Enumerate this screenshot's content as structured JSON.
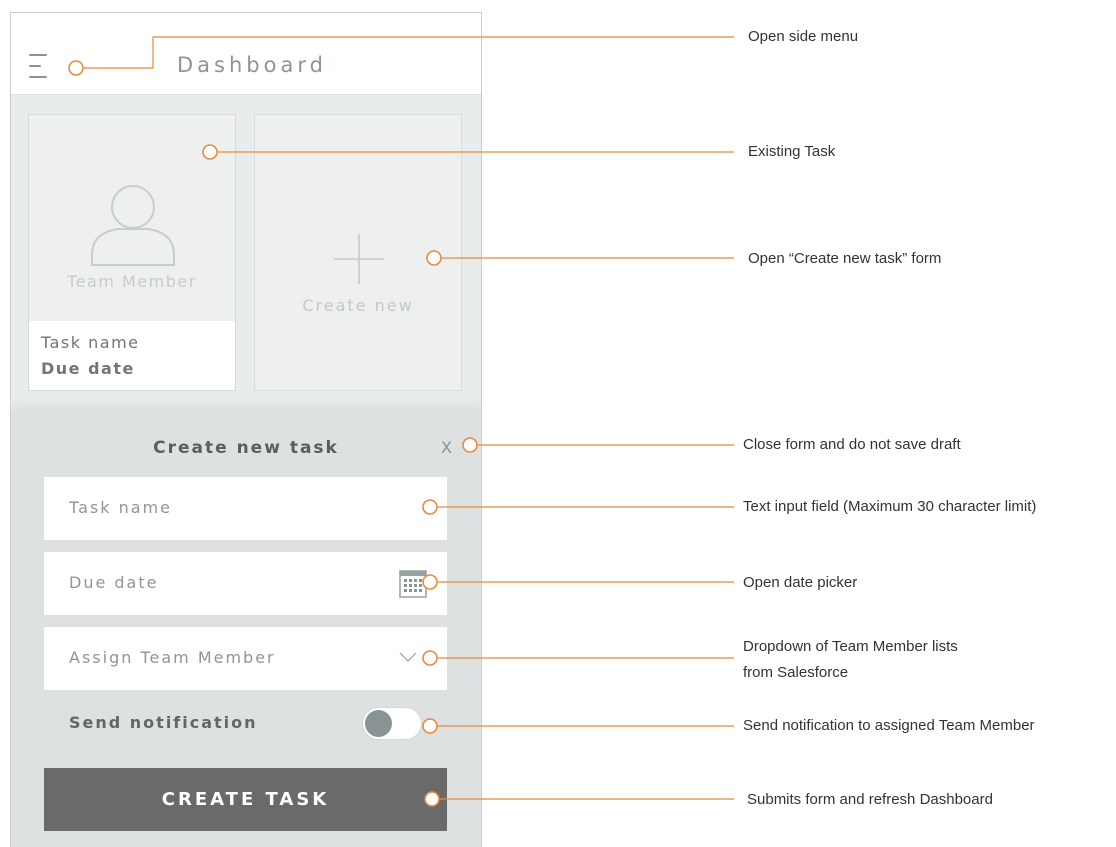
{
  "app": {
    "title": "Dashboard"
  },
  "cards": {
    "existing": {
      "member_label": "Team Member",
      "task_name": "Task name",
      "due_date": "Due date"
    },
    "create": {
      "label": "Create new"
    }
  },
  "form": {
    "title": "Create new task",
    "close_label": "X",
    "task_name_placeholder": "Task name",
    "due_date_placeholder": "Due date",
    "assign_placeholder": "Assign Team Member",
    "notification_label": "Send notification",
    "notification_enabled": false,
    "submit_label": "CREATE TASK"
  },
  "annotations": {
    "side_menu": "Open side menu",
    "existing_task": "Existing Task",
    "open_create": "Open “Create new task” form",
    "close_form": "Close form and do not save draft",
    "text_input": "Text input field (Maximum 30 character limit)",
    "date_picker": "Open date picker",
    "dropdown_line1": "Dropdown of Team Member lists",
    "dropdown_line2": "from Salesforce",
    "send_notification": "Send notification to assigned Team Member",
    "submit": "Submits form and refresh Dashboard"
  },
  "colors": {
    "callout_line": "#e8893b",
    "button_bg": "#6a6a6a",
    "sheet_bg": "#dde1e1"
  }
}
